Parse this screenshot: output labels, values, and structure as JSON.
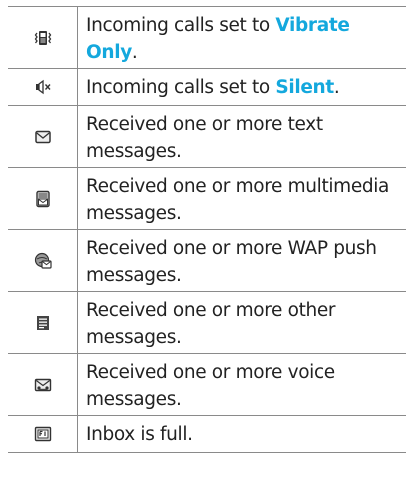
{
  "accent_color": "#14a8dd",
  "rows": [
    {
      "icon": "vibrate-icon",
      "text_before": "Incoming calls set to ",
      "highlight": "Vibrate Only",
      "text_after": "."
    },
    {
      "icon": "silent-icon",
      "text_before": "Incoming calls set to ",
      "highlight": "Silent",
      "text_after": "."
    },
    {
      "icon": "text-message-icon",
      "text": "Received one or more text messages."
    },
    {
      "icon": "multimedia-message-icon",
      "text": "Received one or more multimedia messages."
    },
    {
      "icon": "wap-push-icon",
      "text": "Received one or more WAP push messages."
    },
    {
      "icon": "other-message-icon",
      "text": "Received one or more other messages."
    },
    {
      "icon": "voice-message-icon",
      "text": "Received one or more voice messages."
    },
    {
      "icon": "inbox-full-icon",
      "text": "Inbox is full."
    }
  ]
}
